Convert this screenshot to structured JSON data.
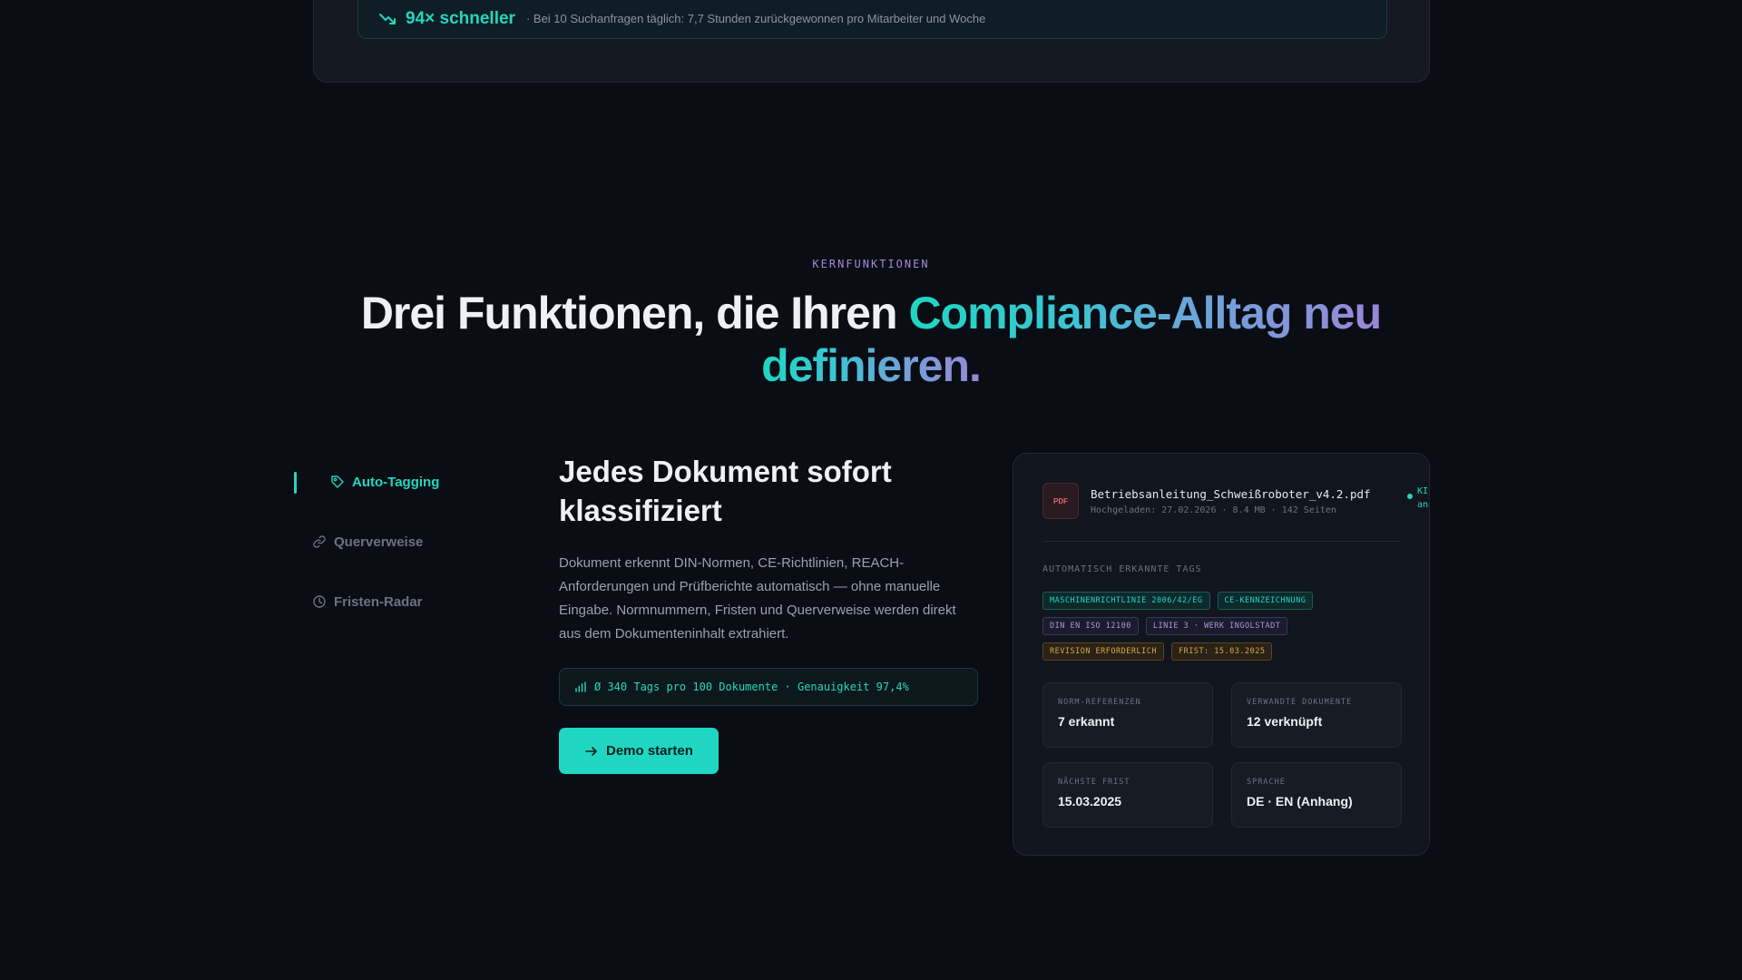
{
  "banner": {
    "speed": "94× schneller",
    "note": "· Bei 10 Suchanfragen täglich: 7,7 Stunden zurückgewonnen pro Mitarbeiter und Woche",
    "icon": "trending-down-icon"
  },
  "section": {
    "eyebrow": "KERNFUNKTIONEN",
    "headline_plain": "Drei Funktionen, die Ihren ",
    "headline_grad_1": "Compliance-Alltag neu",
    "headline_grad_2": "definieren."
  },
  "tabs": [
    {
      "label": "Auto-Tagging",
      "icon": "tag-icon",
      "active": true
    },
    {
      "label": "Querverweise",
      "icon": "link-icon",
      "active": false
    },
    {
      "label": "Fristen-Radar",
      "icon": "clock-icon",
      "active": false
    }
  ],
  "feature": {
    "title": "Jedes Dokument sofort klassifiziert",
    "description": "Dokument erkennt DIN-Normen, CE-Richtlinien, REACH-Anforderungen und Prüfberichte automatisch — ohne manuelle Eingabe. Normnummern, Fristen und Querverweise werden direkt aus dem Dokumenteninhalt extrahiert.",
    "stat": "Ø 340 Tags pro 100 Dokumente · Genauigkeit 97,4%",
    "cta": "Demo starten"
  },
  "document": {
    "badge": "PDF",
    "filename": "Betriebsanleitung_Schweißroboter_v4.2.pdf",
    "meta": "Hochgeladen: 27.02.2026 · 8.4 MB · 142 Seiten",
    "status_line1": "KI",
    "status_line2": "analysi",
    "tags_label": "AUTOMATISCH ERKANNTE TAGS",
    "tags": [
      {
        "text": "MASCHINENRICHTLINIE 2006/42/EG",
        "color": "teal"
      },
      {
        "text": "CE-KENNZEICHNUNG",
        "color": "teal"
      },
      {
        "text": "DIN EN ISO 12100",
        "color": "purple"
      },
      {
        "text": "LINIE 3 · WERK INGOLSTADT",
        "color": "purple"
      },
      {
        "text": "REVISION ERFORDERLICH",
        "color": "amber"
      },
      {
        "text": "FRIST: 15.03.2025",
        "color": "amber"
      }
    ],
    "meta_boxes": [
      {
        "key": "NORM-REFERENZEN",
        "value": "7 erkannt"
      },
      {
        "key": "VERWANDTE DOKUMENTE",
        "value": "12 verknüpft"
      },
      {
        "key": "NÄCHSTE FRIST",
        "value": "15.03.2025"
      },
      {
        "key": "SPRACHE",
        "value": "DE · EN (Anhang)"
      }
    ]
  },
  "colors": {
    "accent": "#24d6c0",
    "background": "#0a0d14",
    "eyebrow": "#a48bd8",
    "amber": "#d8a846"
  }
}
